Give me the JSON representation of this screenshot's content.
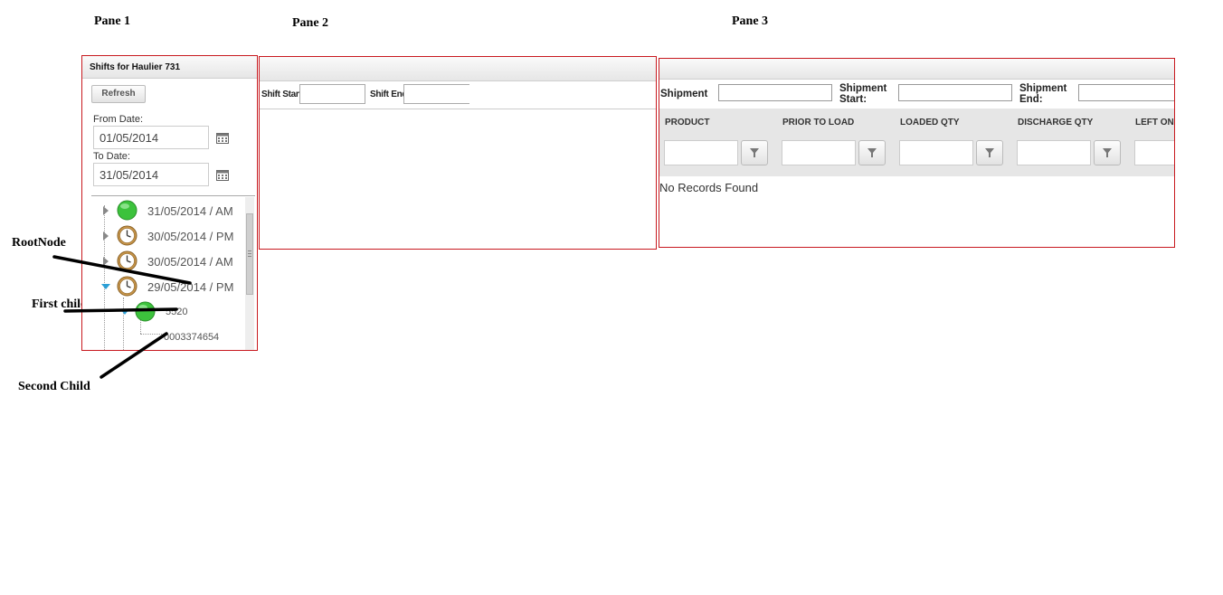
{
  "annotations": {
    "pane1": "Pane 1",
    "pane2": "Pane 2",
    "pane3": "Pane 3",
    "root_node": "RootNode",
    "first_child": "First child",
    "second_child": "Second Child"
  },
  "pane1": {
    "title": "Shifts for Haulier 731",
    "refresh_label": "Refresh",
    "from_label": "From Date:",
    "from_value": "01/05/2014",
    "to_label": "To Date:",
    "to_value": "31/05/2014",
    "tree": [
      {
        "label": "31/05/2014 / AM",
        "icon": "green-status-icon",
        "expanded": false
      },
      {
        "label": "30/05/2014 / PM",
        "icon": "clock-icon",
        "expanded": false
      },
      {
        "label": "30/05/2014 / AM",
        "icon": "clock-icon",
        "expanded": false
      },
      {
        "label": "29/05/2014 / PM",
        "icon": "clock-icon",
        "expanded": true
      },
      {
        "label": "5520",
        "icon": "green-status-icon",
        "expanded": true
      },
      {
        "label": "0003374654",
        "icon": "",
        "expanded": false
      }
    ]
  },
  "pane2": {
    "shift_start_label": "Shift Start:",
    "shift_end_label": "Shift End:"
  },
  "pane3": {
    "shipment_label": "Shipment",
    "shipment_start_label_1": "Shipment",
    "shipment_start_label_2": "Start:",
    "shipment_end_label_1": "Shipment",
    "shipment_end_label_2": "End:",
    "columns": [
      "PRODUCT",
      "PRIOR TO LOAD",
      "LOADED QTY",
      "DISCHARGE QTY",
      "LEFT ON"
    ],
    "empty_message": "No Records Found"
  },
  "colors": {
    "pane_border": "#c8191f",
    "status_green": "#3cc23c",
    "expander_blue": "#2b9fd6"
  }
}
